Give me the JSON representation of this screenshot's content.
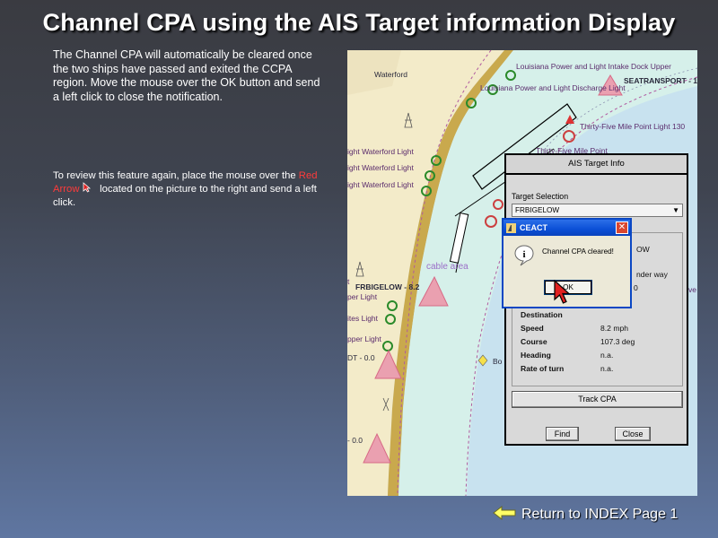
{
  "title": "Channel CPA using the AIS Target information Display",
  "paragraph1": "The Channel CPA will automatically be cleared once the two ships have passed and exited the CCPA region.  Move the mouse over the OK button and send a left click to close the notification.",
  "paragraph2": {
    "before": "To review this feature again,  place the mouse over the ",
    "link": "Red Arrow",
    "after": "located on the picture to the right and send a left click."
  },
  "chart_labels": {
    "waterford": "Waterford",
    "intake_dock": "Louisiana Power and Light Intake Dock Upper",
    "discharge": "Louisiana Power and Light Discharge Light",
    "seatransport": "SEATRANSPORT - 1",
    "thirty_five_light": "Thirty-Five Mile Point Light 130",
    "thirty_five_point": "Thirty-Five Mile Point",
    "wf_light_1": "ight Waterford Light",
    "wf_light_2": "ight Waterford Light",
    "wf_light_3": "ight Waterford Light",
    "cable_area": "cable area",
    "frbigelow": "FRBIGELOW - 8.2",
    "t_label": "t",
    "per_light_1": "per Light",
    "per_light_2": "pper Light",
    "ites_light": "ites Light",
    "dt": "DT - 0.0",
    "bo": "Bo",
    "ve": "ve",
    "minus0": "- 0.0"
  },
  "ais_window": {
    "title": "AIS Target Info",
    "target_selection_label": "Target Selection",
    "selected_target": "FRBIGELOW",
    "partial_low": "OW",
    "partial_under_way": "nder way",
    "partial_zero": "0",
    "destination_label": "Destination",
    "fields": [
      {
        "key": "Speed",
        "value": "8.2 mph"
      },
      {
        "key": "Course",
        "value": "107.3 deg"
      },
      {
        "key": "Heading",
        "value": "n.a."
      },
      {
        "key": "Rate of turn",
        "value": "n.a."
      }
    ],
    "track_cpa": "Track CPA",
    "find": "Find",
    "close": "Close"
  },
  "dialog": {
    "title": "CEACT",
    "message": "Channel CPA cleared!",
    "ok": "OK"
  },
  "return_link": "Return to INDEX Page 1",
  "colors": {
    "link_red": "#ff3b3b",
    "water": "#c8e2ef",
    "land": "#f3ebc9",
    "channel": "#d6f0ea",
    "dialog_title_blue": "#0b4fd6"
  }
}
